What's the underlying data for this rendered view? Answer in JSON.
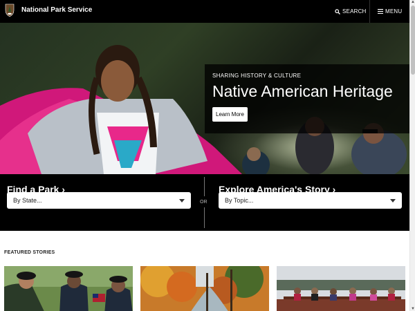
{
  "header": {
    "brand_name": "National Park Service",
    "search_label": "SEARCH",
    "menu_label": "MENU",
    "logo_icon": "arrowhead-logo",
    "background": "#000000"
  },
  "hero": {
    "eyebrow": "SHARING HISTORY & CULTURE",
    "title": "Native American Heritage",
    "button_label": "Learn More"
  },
  "find": {
    "park_title": "Find a Park",
    "park_select_value": "By State...",
    "or_label": "OR",
    "story_title": "Explore America's Story",
    "story_select_value": "By Topic..."
  },
  "featured": {
    "section_label": "FEATURED STORIES",
    "cards": [
      "soldiers-ceremony",
      "autumn-stream",
      "boat-tour"
    ]
  }
}
